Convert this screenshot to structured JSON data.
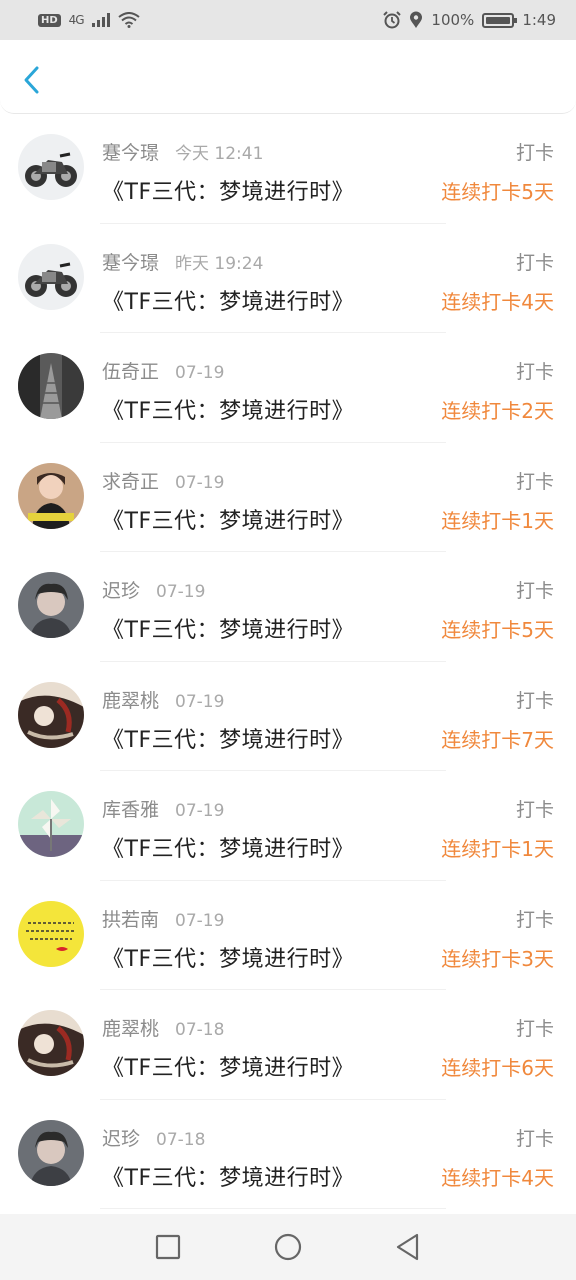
{
  "status_bar": {
    "hd": "HD",
    "network": "4G",
    "battery_percent": "100%",
    "time": "1:49"
  },
  "header": {
    "back_icon": "chevron-left-icon"
  },
  "colors": {
    "accent": "#2aa6d8",
    "streak": "#f0883c"
  },
  "records": [
    {
      "name": "蹇今璟",
      "time": "今天 12:41",
      "tag": "打卡",
      "title": "《TF三代：梦境进行时》",
      "streak": "连续打卡5天",
      "avatar": "motorcycle"
    },
    {
      "name": "蹇今璟",
      "time": "昨天 19:24",
      "tag": "打卡",
      "title": "《TF三代：梦境进行时》",
      "streak": "连续打卡4天",
      "avatar": "motorcycle"
    },
    {
      "name": "伍奇正",
      "time": "07-19",
      "tag": "打卡",
      "title": "《TF三代：梦境进行时》",
      "streak": "连续打卡2天",
      "avatar": "bw-street"
    },
    {
      "name": "求奇正",
      "time": "07-19",
      "tag": "打卡",
      "title": "《TF三代：梦境进行时》",
      "streak": "连续打卡1天",
      "avatar": "woman"
    },
    {
      "name": "迟珍",
      "time": "07-19",
      "tag": "打卡",
      "title": "《TF三代：梦境进行时》",
      "streak": "连续打卡5天",
      "avatar": "boy"
    },
    {
      "name": "鹿翠桃",
      "time": "07-19",
      "tag": "打卡",
      "title": "《TF三代：梦境进行时》",
      "streak": "连续打卡7天",
      "avatar": "art"
    },
    {
      "name": "库香雅",
      "time": "07-19",
      "tag": "打卡",
      "title": "《TF三代：梦境进行时》",
      "streak": "连续打卡1天",
      "avatar": "pinwheel"
    },
    {
      "name": "拱若南",
      "time": "07-19",
      "tag": "打卡",
      "title": "《TF三代：梦境进行时》",
      "streak": "连续打卡3天",
      "avatar": "yellow-text"
    },
    {
      "name": "鹿翠桃",
      "time": "07-18",
      "tag": "打卡",
      "title": "《TF三代：梦境进行时》",
      "streak": "连续打卡6天",
      "avatar": "art"
    },
    {
      "name": "迟珍",
      "time": "07-18",
      "tag": "打卡",
      "title": "《TF三代：梦境进行时》",
      "streak": "连续打卡4天",
      "avatar": "boy"
    }
  ],
  "nav": {
    "recent": "square-icon",
    "home": "circle-icon",
    "back": "triangle-back-icon"
  }
}
